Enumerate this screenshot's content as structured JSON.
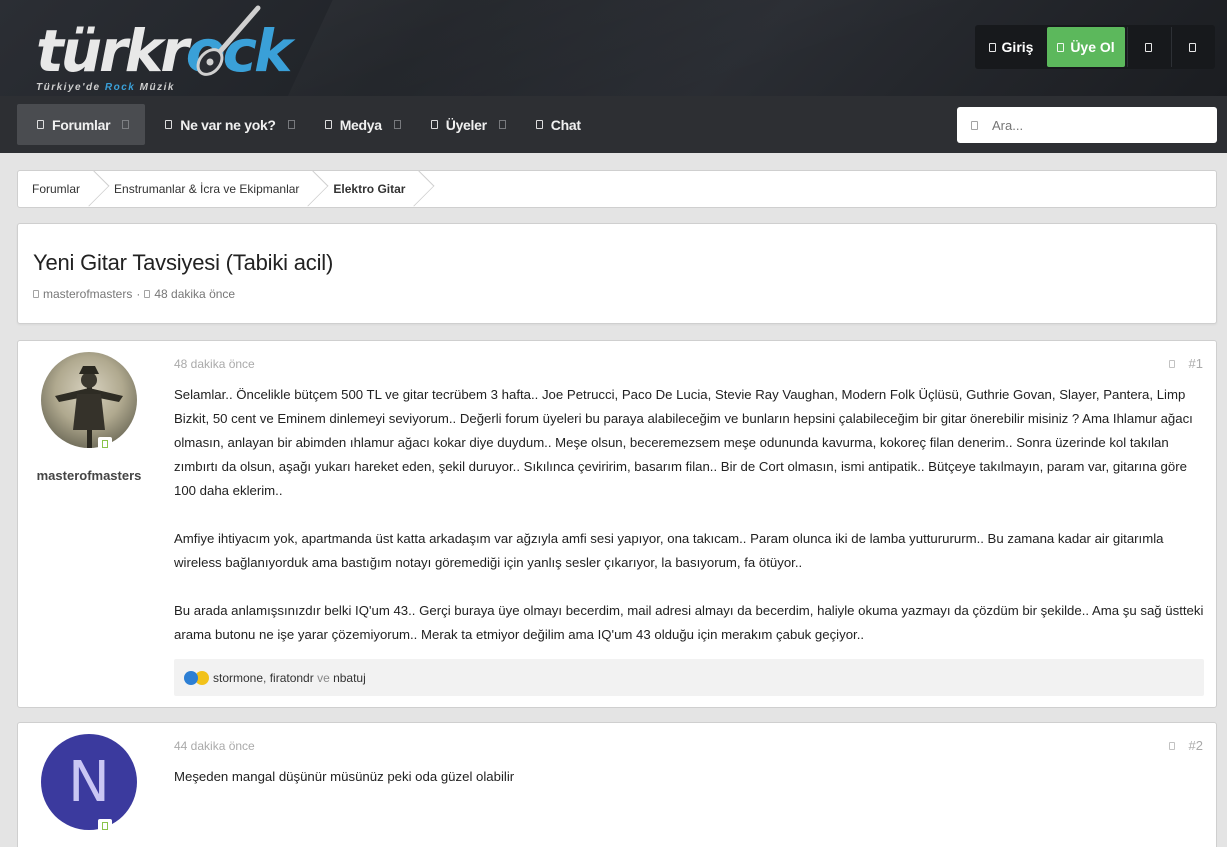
{
  "brand": {
    "logo_prefix": "türkr",
    "logo_o": "o",
    "logo_suffix": "ck",
    "tagline_1": "Türkiye'de ",
    "tagline_rock": "Rock",
    "tagline_2": " Müzik"
  },
  "header": {
    "login_label": "Giriş",
    "register_label": "Üye Ol"
  },
  "nav": {
    "items": [
      {
        "label": "Forumlar"
      },
      {
        "label": "Ne var ne yok?"
      },
      {
        "label": "Medya"
      },
      {
        "label": "Üyeler"
      },
      {
        "label": "Chat"
      }
    ],
    "search_placeholder": "Ara..."
  },
  "breadcrumb": [
    "Forumlar",
    "Enstrumanlar & İcra ve Ekipmanlar",
    "Elektro Gitar"
  ],
  "thread": {
    "title": "Yeni Gitar Tavsiyesi (Tabiki acil)",
    "author": "masterofmasters",
    "separator": "·",
    "time": "48 dakika önce"
  },
  "posts": [
    {
      "username": "masterofmasters",
      "date": "48 dakika önce",
      "number": "#1",
      "paragraphs": [
        "Selamlar.. Öncelikle bütçem 500 TL ve gitar tecrübem 3 hafta.. Joe Petrucci, Paco De Lucia, Stevie Ray Vaughan, Modern Folk Üçlüsü, Guthrie Govan, Slayer, Pantera, Limp Bizkit, 50 cent ve Eminem dinlemeyi seviyorum.. Değerli forum üyeleri bu paraya alabileceğim ve bunların hepsini çalabileceğim bir gitar önerebilir misiniz ? Ama Ihlamur ağacı olmasın, anlayan bir abimden ıhlamur ağacı kokar diye duydum.. Meşe olsun, beceremezsem meşe odununda kavurma, kokoreç filan denerim.. Sonra üzerinde kol takılan zımbırtı da olsun, aşağı yukarı hareket eden, şekil duruyor.. Sıkılınca çeviririm, basarım filan.. Bir de Cort olmasın, ismi antipatik.. Bütçeye takılmayın, param var, gitarına göre 100 daha eklerim..",
        "Amfiye ihtiyacım yok, apartmanda üst katta arkadaşım var ağzıyla amfi sesi yapıyor, ona takıcam.. Param olunca iki de lamba yutturururm.. Bu zamana kadar air gitarımla wireless bağlanıyorduk ama bastığım notayı göremediği için yanlış sesler çıkarıyor, la basıyorum, fa ötüyor..",
        "Bu arada anlamışsınızdır belki IQ'um 43.. Gerçi buraya üye olmayı becerdim, mail adresi almayı da becerdim, haliyle okuma yazmayı da çözdüm bir şekilde.. Ama şu sağ üstteki arama butonu ne işe yarar çözemiyorum.. Merak ta etmiyor değilim ama IQ'um 43 olduğu için merakım çabuk geçiyor.."
      ],
      "reactions": {
        "user1": "stormone",
        "comma": ", ",
        "user2": "firatondr",
        "conj": " ve ",
        "user3": "nbatuj"
      }
    },
    {
      "avatar_letter": "N",
      "date": "44 dakika önce",
      "number": "#2",
      "paragraphs": [
        "Meşeden mangal düşünür müsünüz peki oda güzel olabilir"
      ]
    }
  ],
  "colors": {
    "brand_blue": "#3aa0d8",
    "register_green": "#5cb85c",
    "nav_bg": "#2d2f33",
    "avatar_purple": "#3b3a9e"
  }
}
